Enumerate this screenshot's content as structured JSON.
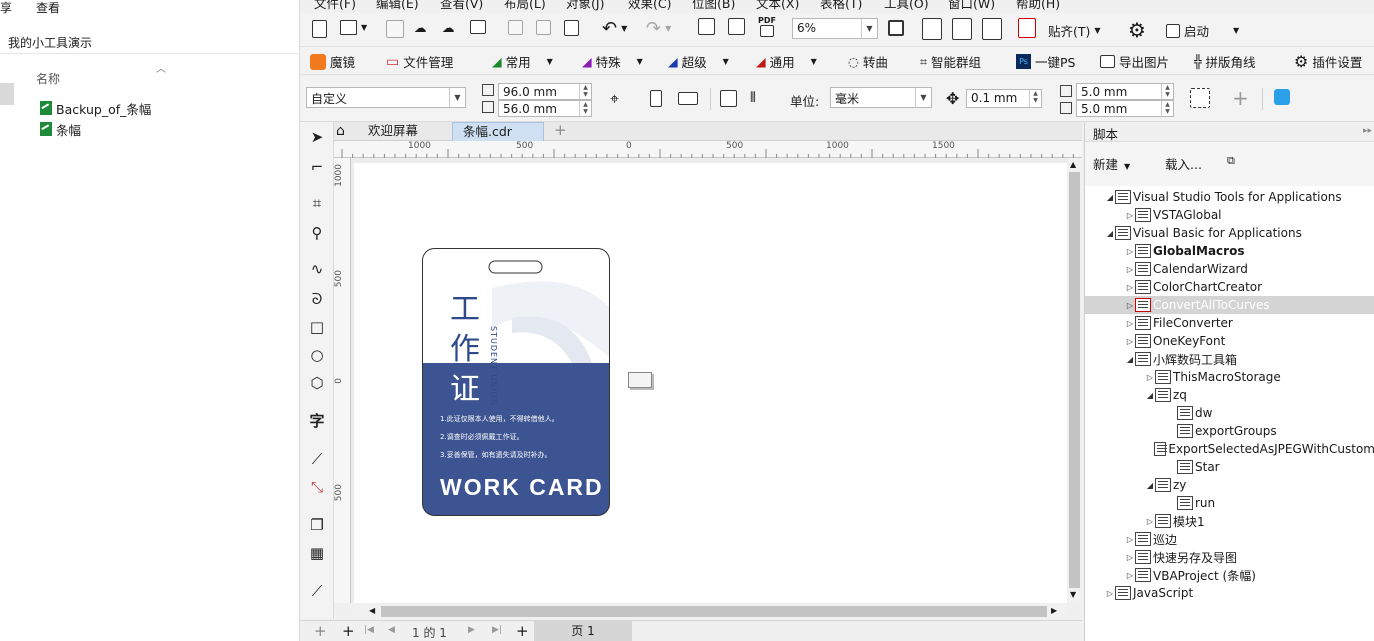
{
  "explorer": {
    "menu": [
      "享",
      "查看"
    ],
    "breadcrumb": "我的小工具演示",
    "column_name": "名称",
    "files": [
      "Backup_of_条幅",
      "条幅"
    ]
  },
  "menubar": [
    "文件(F)",
    "编辑(E)",
    "查看(V)",
    "布局(L)",
    "对象(J)",
    "效果(C)",
    "位图(B)",
    "文本(X)",
    "表格(T)",
    "工具(O)",
    "窗口(W)",
    "帮助(H)"
  ],
  "toolbar1": {
    "zoom": "6%",
    "snap": "贴齐(T)",
    "launch": "启动",
    "pdf_label": "PDF"
  },
  "toolbar2": {
    "items": [
      "魔镜",
      "文件管理",
      "常用",
      "特殊",
      "超级",
      "通用",
      "转曲",
      "智能群组",
      "一键PS",
      "导出图片",
      "拼版角线",
      "插件设置"
    ]
  },
  "propbar": {
    "preset": "自定义",
    "width": "96.0 mm",
    "height": "56.0 mm",
    "unit_label": "单位:",
    "unit": "毫米",
    "nudge": "0.1 mm",
    "dup_x": "5.0 mm",
    "dup_y": "5.0 mm"
  },
  "tabs": {
    "welcome": "欢迎屏幕",
    "doc": "条幅.cdr"
  },
  "rulers": {
    "h_ticks": [
      "1000",
      "500",
      "0",
      "500",
      "1000",
      "1500"
    ],
    "v_ticks": [
      "1000",
      "500",
      "0",
      "500"
    ]
  },
  "card": {
    "char1": "工",
    "char2": "作",
    "char3": "证",
    "vertical_text": "STUDENT UNION",
    "rules": [
      "1.此证仅限本人使用，不得转借他人。",
      "2.调查时必须佩戴工作证。",
      "3.妥善保管，如有遗失请及时补办。"
    ],
    "title": "WORK CARD",
    "colors": {
      "navy": "#3d5492",
      "frame": "#333333"
    }
  },
  "pagenav": {
    "counter": "1 的 1",
    "page_tab": "页 1"
  },
  "docker": {
    "title": "脚本",
    "new_label": "新建",
    "load_label": "载入...",
    "tree": [
      {
        "label": "Visual Studio Tools for Applications",
        "depth": 1,
        "expanded": true
      },
      {
        "label": "VSTAGlobal",
        "depth": 2,
        "expanded": false
      },
      {
        "label": "Visual Basic for Applications",
        "depth": 1,
        "expanded": true
      },
      {
        "label": "GlobalMacros",
        "depth": 2,
        "expanded": false,
        "bold": true
      },
      {
        "label": "CalendarWizard",
        "depth": 2,
        "expanded": false
      },
      {
        "label": "ColorChartCreator",
        "depth": 2,
        "expanded": false
      },
      {
        "label": "ConvertAllToCurves",
        "depth": 2,
        "expanded": false,
        "highlighted": true
      },
      {
        "label": "FileConverter",
        "depth": 2,
        "expanded": false
      },
      {
        "label": "OneKeyFont",
        "depth": 2,
        "expanded": false
      },
      {
        "label": "小辉数码工具箱",
        "depth": 2,
        "expanded": true
      },
      {
        "label": "ThisMacroStorage",
        "depth": 3,
        "expanded": false
      },
      {
        "label": "zq",
        "depth": 3,
        "expanded": true
      },
      {
        "label": "dw",
        "depth": 4,
        "leaf": true
      },
      {
        "label": "exportGroups",
        "depth": 4,
        "leaf": true
      },
      {
        "label": "ExportSelectedAsJPEGWithCustom",
        "depth": 4,
        "leaf": true
      },
      {
        "label": "Star",
        "depth": 4,
        "leaf": true
      },
      {
        "label": "zy",
        "depth": 3,
        "expanded": true
      },
      {
        "label": "run",
        "depth": 4,
        "leaf": true
      },
      {
        "label": "模块1",
        "depth": 3,
        "expanded": false
      },
      {
        "label": "巡边",
        "depth": 2,
        "expanded": false
      },
      {
        "label": "快速另存及导图",
        "depth": 2,
        "expanded": false
      },
      {
        "label": "VBAProject (条幅)",
        "depth": 2,
        "expanded": false
      },
      {
        "label": "JavaScript",
        "depth": 1,
        "expanded": false
      }
    ]
  }
}
